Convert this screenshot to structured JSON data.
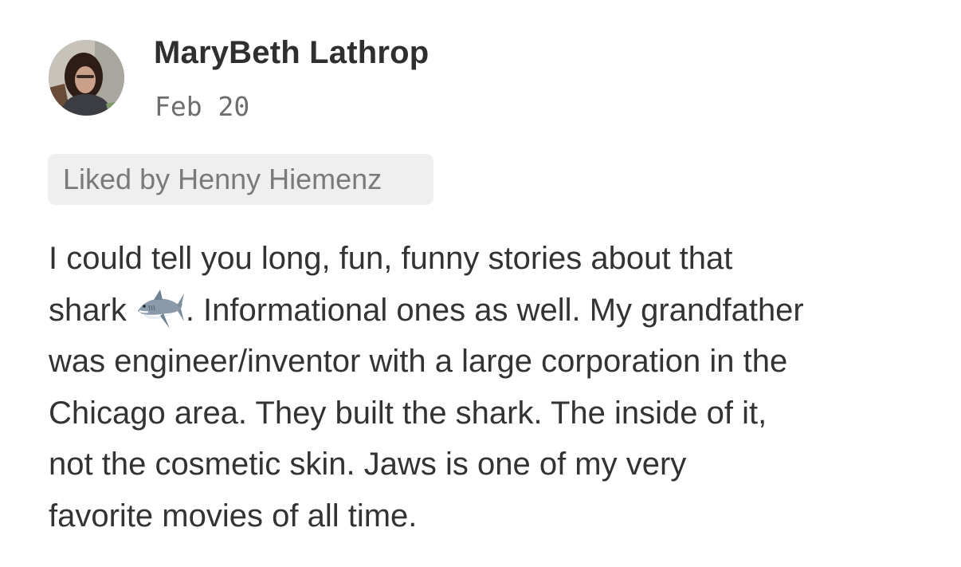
{
  "post": {
    "author": {
      "name": "MaryBeth Lathrop",
      "avatar_icon": "profile-photo-avatar"
    },
    "date": "Feb 20",
    "liked_by": "Liked by Henny Hiemenz",
    "body": {
      "line_1": "I could tell you long, fun, funny stories about that",
      "line_2_before_emoji": "shark",
      "emoji_icon": "shark-icon",
      "line_2_after_emoji": ". Informational ones as well. My grandfather",
      "line_3": "was engineer/inventor with a large corporation in the",
      "line_4": "Chicago area. They built the shark. The inside of it,",
      "line_5": "not the cosmetic skin. Jaws is one of my very",
      "line_6": "favorite movies of all time."
    }
  },
  "colors": {
    "background": "#ffffff",
    "text": "#333333",
    "date_text": "#6d6d6d",
    "chip_background": "#efefef",
    "chip_text": "#7a7a7a"
  }
}
